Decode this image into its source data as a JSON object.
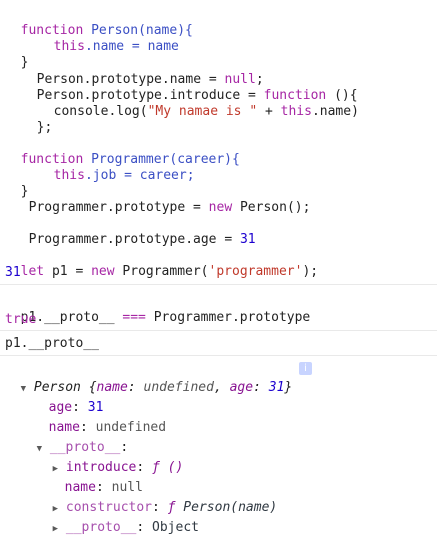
{
  "code_block": {
    "l1_kw": "function",
    "l1_name": "Person",
    "l1_param": "(name){",
    "l2_this": "this",
    "l2_rest": ".name = name",
    "l3": "}",
    "l4_a": "Person.prototype.name = ",
    "l4_null": "null",
    "l4_semi": ";",
    "l5_a": "Person.prototype.introduce = ",
    "l5_fn": "function",
    "l5_b": " (){",
    "l6_a": "console.log(",
    "l6_str": "\"My namae is \"",
    "l6_b": " + ",
    "l6_this": "this",
    "l6_c": ".name)",
    "l7": "};",
    "l9_kw": "function",
    "l9_name": "Programmer",
    "l9_param": "(career){",
    "l10_this": "this",
    "l10_rest": ".job = career;",
    "l11": "}",
    "l12_a": "Programmer.prototype = ",
    "l12_new": "new",
    "l12_b": " Person();",
    "l14_a": "Programmer.prototype.age = ",
    "l14_num": "31",
    "l16_let": "let",
    "l16_a": " p1 = ",
    "l16_new": "new",
    "l16_b": " Programmer(",
    "l16_str": "'programmer'",
    "l16_c": ");"
  },
  "console": {
    "out1": "31",
    "in2_a": "p1.__proto__ ",
    "in2_op": "===",
    "in2_b": " Programmer.prototype",
    "out2": "true",
    "in3": "p1.__proto__"
  },
  "tree": {
    "root_class": "Person",
    "root_preview_open": " {",
    "root_k1": "name",
    "root_v1": "undefined",
    "root_k2": "age",
    "root_v2": "31",
    "root_close": "}",
    "info_glyph": "i",
    "age_key": "age",
    "age_val": "31",
    "name_key": "name",
    "name_val": "undefined",
    "proto_key": "__proto__",
    "proto_colon": ":",
    "introduce_key": "introduce",
    "introduce_val": "ƒ ()",
    "pname_key": "name",
    "pname_val": "null",
    "ctor_key": "constructor",
    "ctor_f": "ƒ",
    "ctor_val": " Person(name)",
    "proto2_key": "__proto__",
    "proto2_val": "Object"
  }
}
